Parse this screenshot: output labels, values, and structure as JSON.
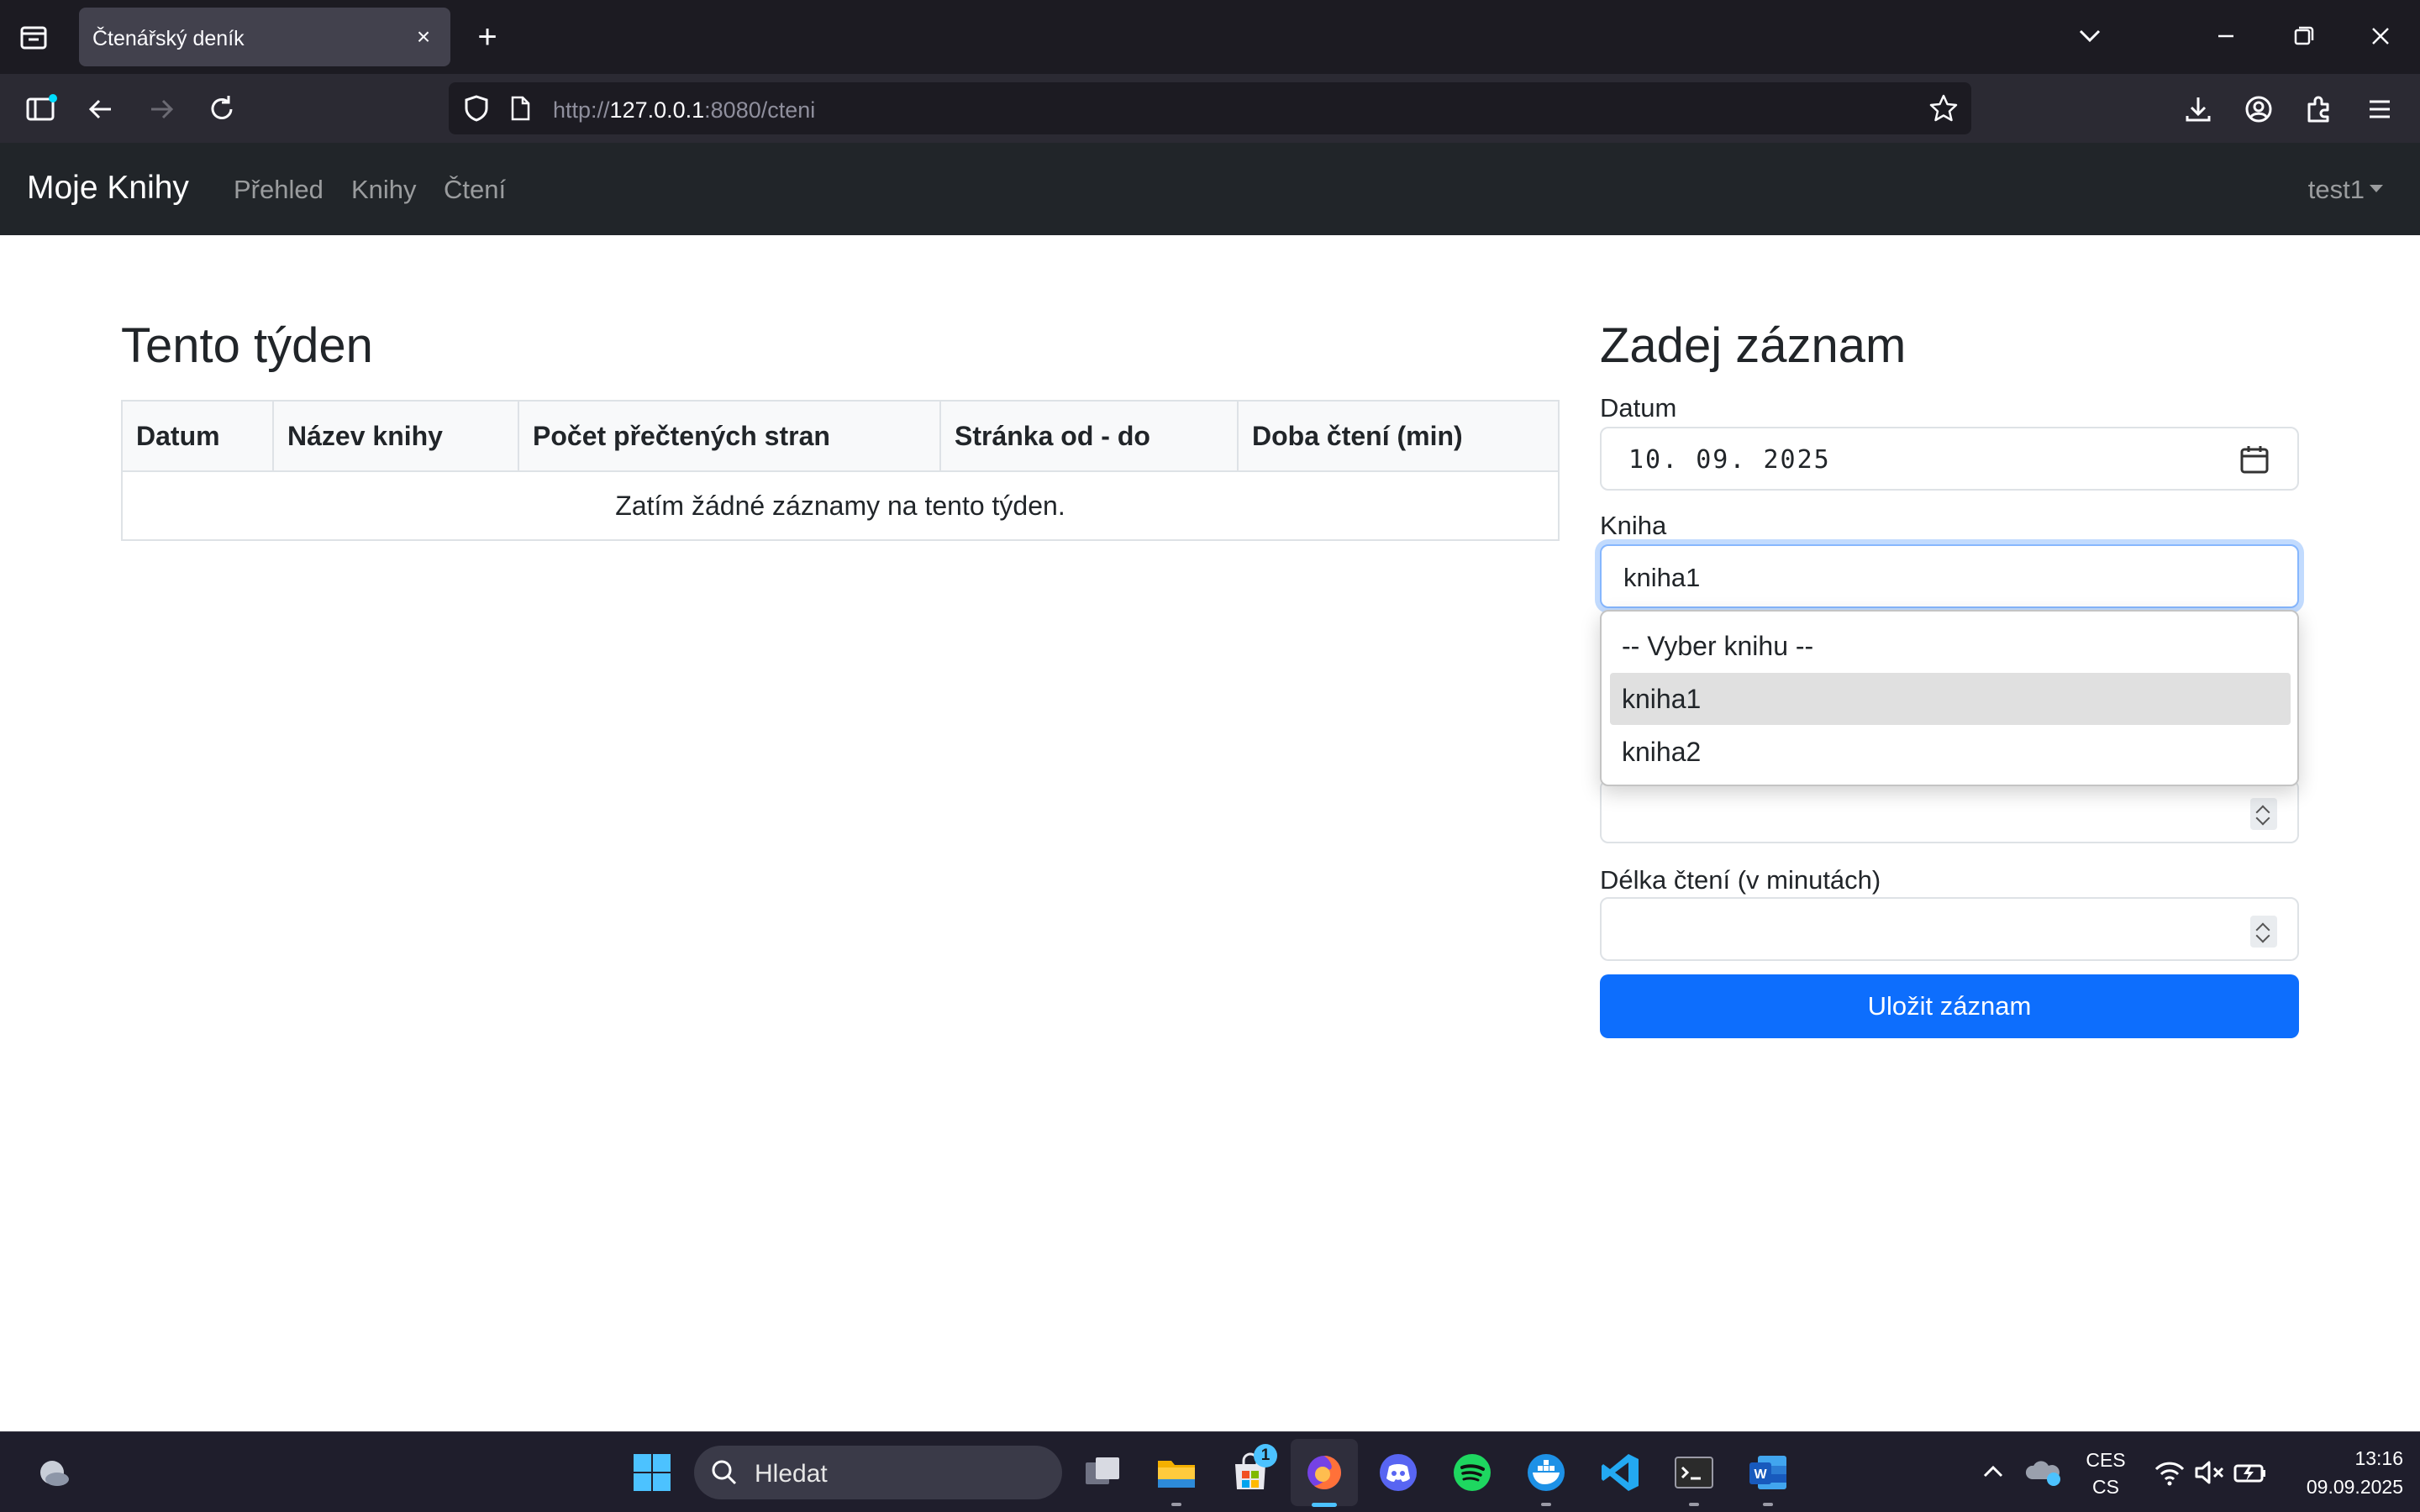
{
  "browser": {
    "tab_title": "Čtenářský deník",
    "tab_close": "×",
    "new_tab": "+",
    "url_prefix": "http://",
    "url_host": "127.0.0.1",
    "url_rest": ":8080/cteni"
  },
  "app": {
    "brand": "Moje Knihy",
    "nav": [
      "Přehled",
      "Knihy",
      "Čtení"
    ],
    "user": "test1"
  },
  "week": {
    "title": "Tento týden",
    "columns": [
      "Datum",
      "Název knihy",
      "Počet přečtených stran",
      "Stránka od - do",
      "Doba čtení (min)"
    ],
    "empty_message": "Zatím žádné záznamy na tento týden."
  },
  "form": {
    "title": "Zadej záznam",
    "date_label": "Datum",
    "date_value": "10. 09. 2025",
    "book_label": "Kniha",
    "book_value": "kniha1",
    "book_options": [
      "-- Vyber knihu --",
      "kniha1",
      "kniha2"
    ],
    "duration_label": "Délka čtení (v minutách)",
    "save_label": "Uložit záznam"
  },
  "taskbar": {
    "search_placeholder": "Hledat",
    "store_badge": "1",
    "lang_top": "CES",
    "lang_bottom": "CS",
    "time": "13:16",
    "date": "09.09.2025"
  },
  "colors": {
    "primary": "#0d6efd",
    "appbar": "#212529",
    "browser_dark": "#1c1b22"
  }
}
